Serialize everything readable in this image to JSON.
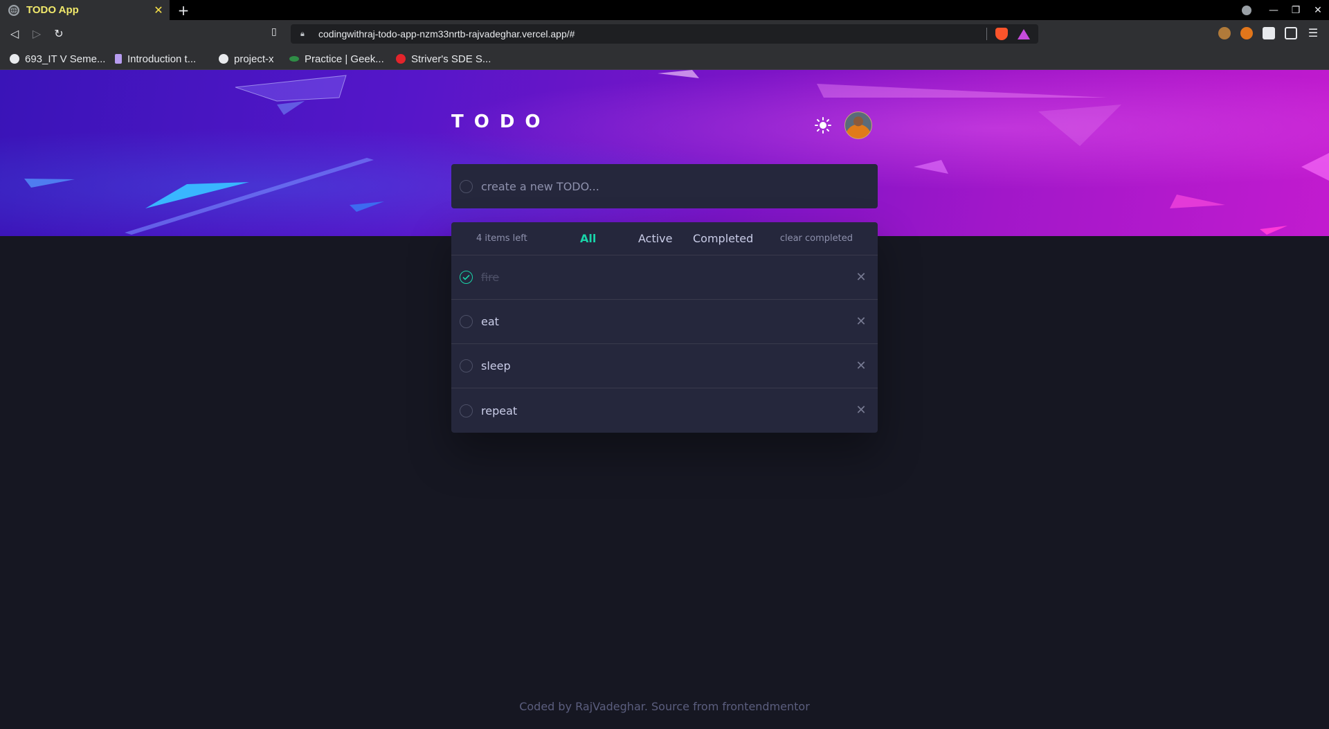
{
  "browser": {
    "tab_title": "TODO App",
    "tab_close": "✕",
    "new_tab": "+",
    "url": "codingwithraj-todo-app-nzm33nrtb-rajvadeghar.vercel.app/#",
    "bookmarks": [
      {
        "label": "693_IT V Seme...",
        "icon_color": "#e8eaed"
      },
      {
        "label": "Introduction t...",
        "icon_color": "#b79cf0"
      },
      {
        "label": "project-x",
        "icon_color": "#e8eaed"
      },
      {
        "label": "Practice | Geek...",
        "icon_color": "#2f8d46"
      },
      {
        "label": "Striver's SDE S...",
        "icon_color": "#e3242b"
      }
    ]
  },
  "app": {
    "logo": "TODO",
    "new_todo_placeholder": "create a new TODO...",
    "items_left": "4 items left",
    "filters": {
      "all": "All",
      "active": "Active",
      "completed": "Completed"
    },
    "active_filter": "All",
    "clear_completed": "clear completed",
    "todos": [
      {
        "text": "fire",
        "completed": true
      },
      {
        "text": "eat",
        "completed": false
      },
      {
        "text": "sleep",
        "completed": false
      },
      {
        "text": "repeat",
        "completed": false
      }
    ],
    "delete_glyph": "✕",
    "footer": "Coded by RajVadeghar. Source from frontendmentor",
    "colors": {
      "accent": "#19d3a8",
      "panel": "#25273c",
      "page": "#161722"
    }
  }
}
